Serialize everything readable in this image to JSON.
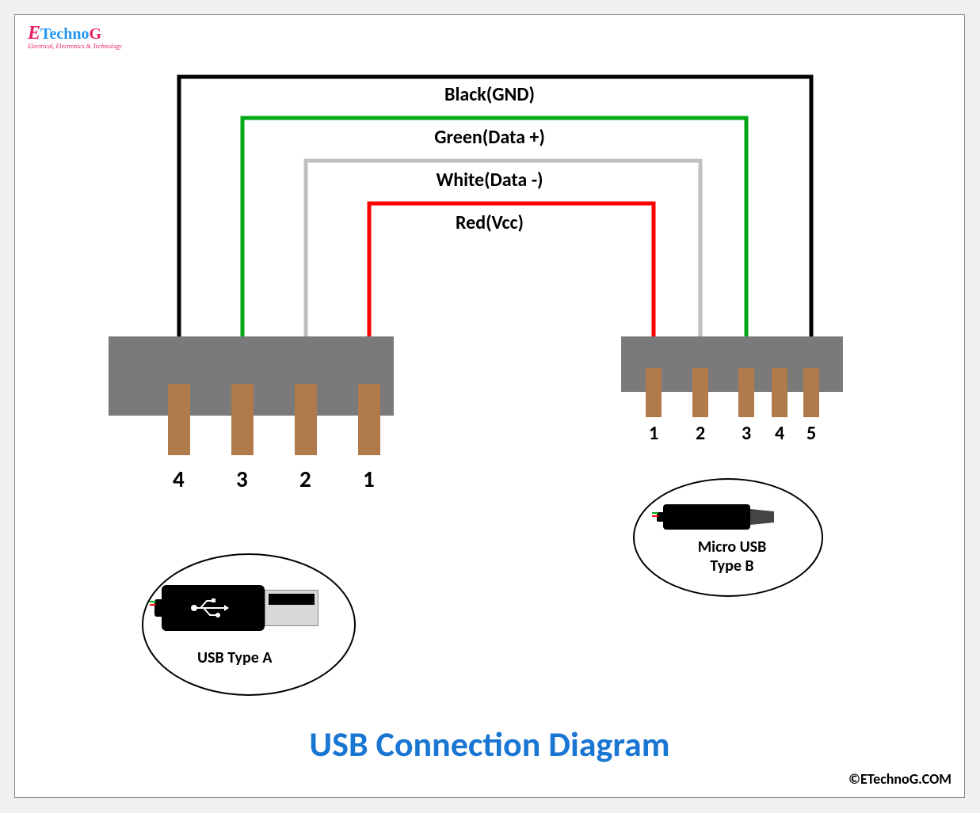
{
  "logo": {
    "e": "E",
    "techno": "Techno",
    "g": "G",
    "tagline": "Electrical, Electronics & Technology"
  },
  "wires": {
    "black": {
      "label": "Black(GND)",
      "color": "#000000"
    },
    "green": {
      "label": "Green(Data +)",
      "color": "#00a815"
    },
    "white": {
      "label": "White(Data -)",
      "color": "#c0c0c0"
    },
    "red": {
      "label": "Red(Vcc)",
      "color": "#ff0000"
    }
  },
  "left_connector": {
    "name": "USB Type A",
    "pins": [
      "4",
      "3",
      "2",
      "1"
    ]
  },
  "right_connector": {
    "name": "Micro USB Type B",
    "pins": [
      "1",
      "2",
      "3",
      "4",
      "5"
    ]
  },
  "title": "USB Connection Diagram",
  "copyright": "©ETechnoG.COM"
}
